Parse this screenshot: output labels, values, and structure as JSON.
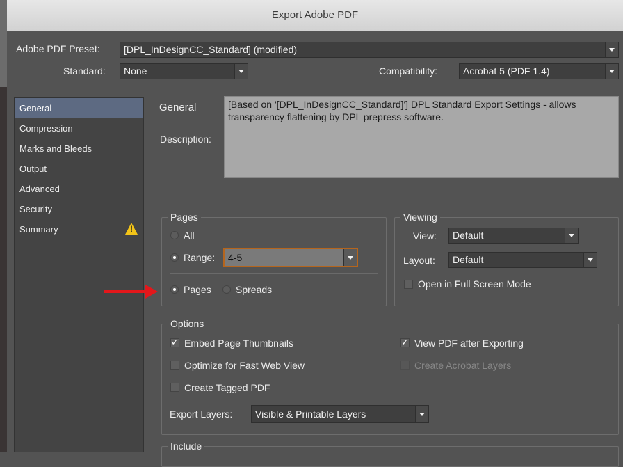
{
  "window": {
    "title": "Export Adobe PDF"
  },
  "preset": {
    "label": "Adobe PDF Preset:",
    "value": "[DPL_InDesignCC_Standard] (modified)"
  },
  "standard": {
    "label": "Standard:",
    "value": "None"
  },
  "compatibility": {
    "label": "Compatibility:",
    "value": "Acrobat 5 (PDF 1.4)"
  },
  "sidebar": {
    "items": [
      {
        "label": "General"
      },
      {
        "label": "Compression"
      },
      {
        "label": "Marks and Bleeds"
      },
      {
        "label": "Output"
      },
      {
        "label": "Advanced"
      },
      {
        "label": "Security"
      },
      {
        "label": "Summary"
      }
    ],
    "warning_glyph": "!"
  },
  "main": {
    "section_title": "General",
    "description_label": "Description:",
    "description_text": "[Based on '[DPL_InDesignCC_Standard]'] DPL Standard Export Settings - allows transparency flattening by DPL prepress software."
  },
  "pages": {
    "legend": "Pages",
    "all_label": "All",
    "range_label": "Range:",
    "range_value": "4-5",
    "pages_label": "Pages",
    "spreads_label": "Spreads"
  },
  "viewing": {
    "legend": "Viewing",
    "view_label": "View:",
    "view_value": "Default",
    "layout_label": "Layout:",
    "layout_value": "Default",
    "fullscreen_label": "Open in Full Screen Mode"
  },
  "options": {
    "legend": "Options",
    "embed_thumbnails": "Embed Page Thumbnails",
    "optimize_web": "Optimize for Fast Web View",
    "tagged_pdf": "Create Tagged PDF",
    "view_after_export": "View PDF after Exporting",
    "acrobat_layers": "Create Acrobat Layers",
    "export_layers_label": "Export Layers:",
    "export_layers_value": "Visible & Printable Layers",
    "check_glyph": "✓"
  },
  "include": {
    "legend": "Include"
  },
  "colors": {
    "annotation_arrow": "#e3171b",
    "selected_item": "#5d6a82",
    "warning": "#f3c418"
  }
}
